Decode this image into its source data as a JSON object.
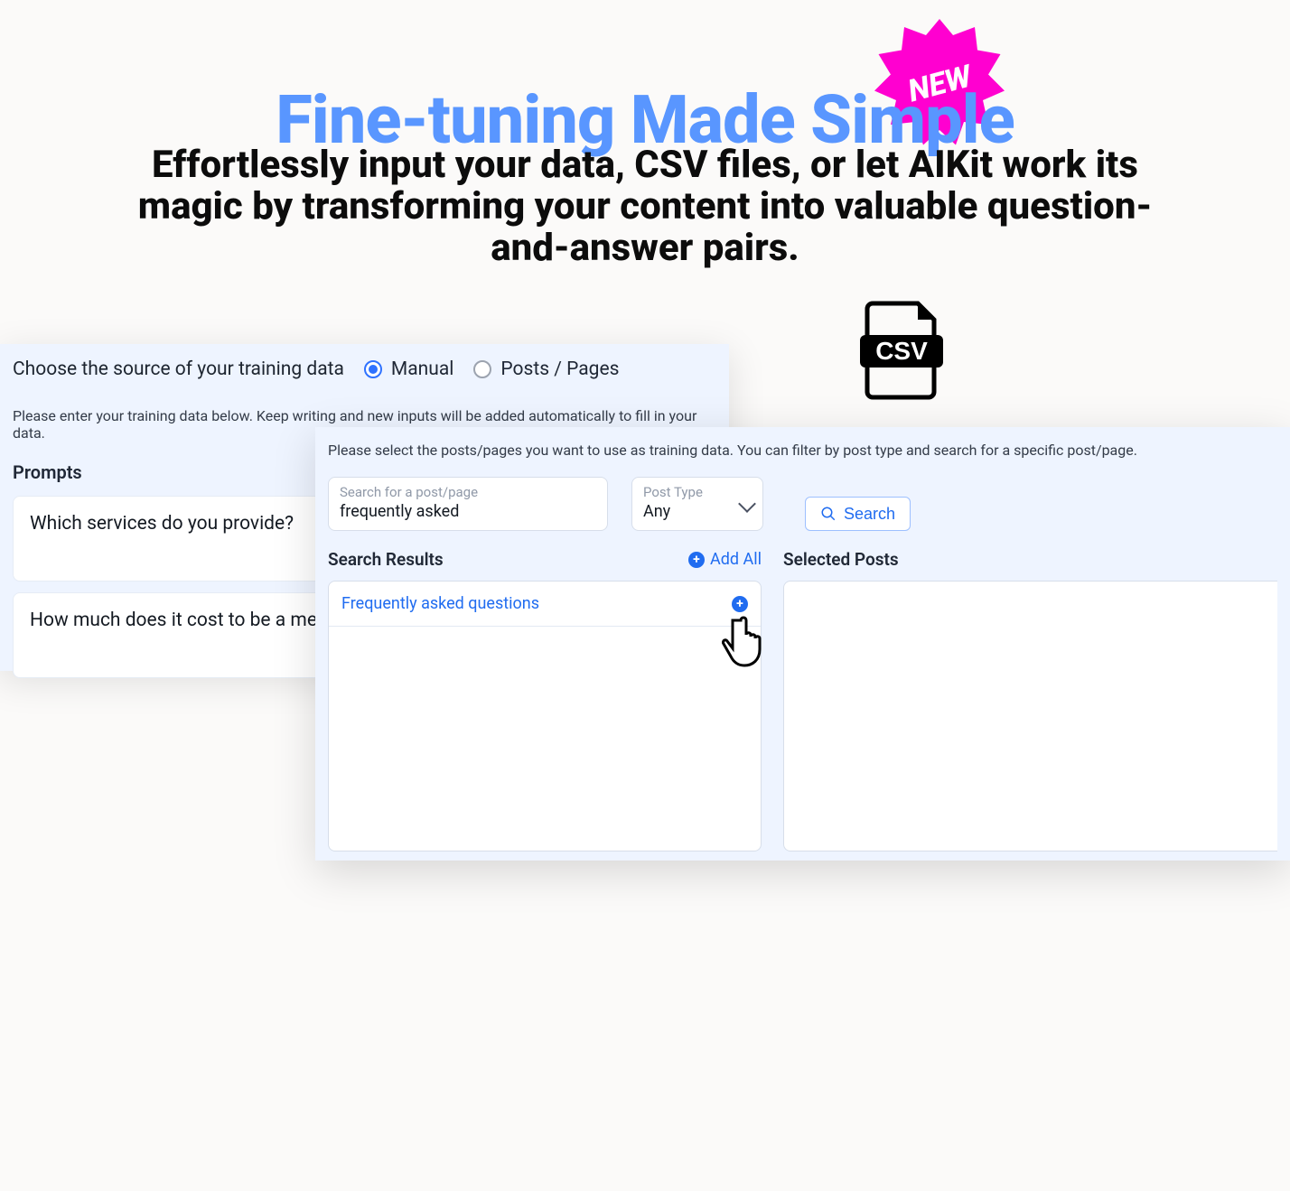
{
  "badge": {
    "label": "NEW"
  },
  "header": {
    "title": "Fine-tuning Made Simple",
    "subtitle": "Effortlessly input your data, CSV files, or let AIKit work its magic by transforming your content into valuable question-and-answer pairs."
  },
  "csv_icon": {
    "label": "CSV"
  },
  "left_card": {
    "source_label": "Choose the source of your training data",
    "options": {
      "manual": "Manual",
      "posts_pages": "Posts / Pages",
      "selected": "manual"
    },
    "hint": "Please enter your training data below. Keep writing and new inputs will be added automatically to fill in your data.",
    "prompts_label": "Prompts",
    "prompts": [
      "Which services do you provide?",
      "How much does it cost to be a member?"
    ]
  },
  "right_card": {
    "hint": "Please select the posts/pages you want to use as training data. You can filter by post type and search for a specific post/page.",
    "search": {
      "label": "Search for a post/page",
      "value": "frequently asked"
    },
    "post_type": {
      "label": "Post Type",
      "value": "Any"
    },
    "search_button": "Search",
    "results_label": "Search Results",
    "add_all_label": "Add All",
    "results": [
      "Frequently asked questions"
    ],
    "selected_label": "Selected Posts"
  },
  "colors": {
    "accent": "#5996ff",
    "link": "#206cf0",
    "badge": "#ff00d0"
  }
}
